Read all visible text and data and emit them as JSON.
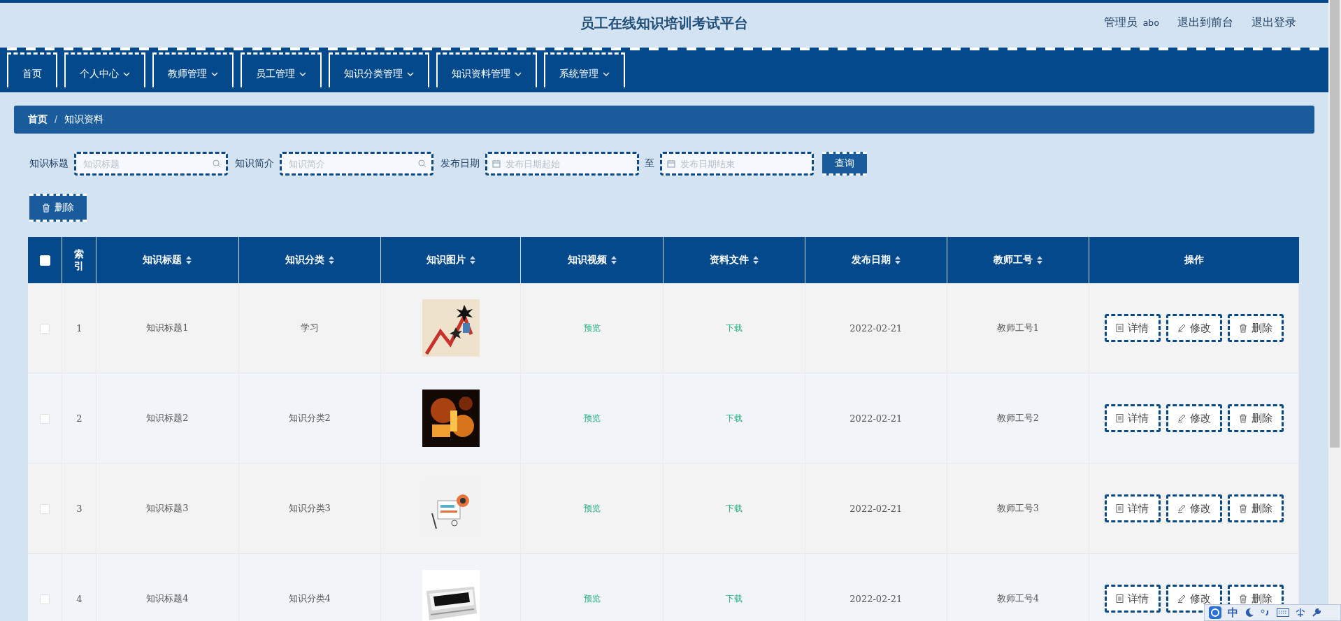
{
  "header": {
    "title": "员工在线知识培训考试平台",
    "role": "管理员",
    "username": "abo",
    "links": [
      "退出到前台",
      "退出登录"
    ]
  },
  "nav": [
    {
      "label": "首页",
      "dropdown": false
    },
    {
      "label": "个人中心",
      "dropdown": true
    },
    {
      "label": "教师管理",
      "dropdown": true
    },
    {
      "label": "员工管理",
      "dropdown": true
    },
    {
      "label": "知识分类管理",
      "dropdown": true
    },
    {
      "label": "知识资料管理",
      "dropdown": true
    },
    {
      "label": "系统管理",
      "dropdown": true
    }
  ],
  "breadcrumb": {
    "items": [
      "首页",
      "知识资料"
    ],
    "separator": "/"
  },
  "search": {
    "fields": [
      {
        "label": "知识标题",
        "placeholder": "知识标题"
      },
      {
        "label": "知识简介",
        "placeholder": "知识简介"
      }
    ],
    "date_range": {
      "label": "发布日期",
      "start_placeholder": "发布日期起始",
      "separator": "至",
      "end_placeholder": "发布日期结束"
    },
    "button": "查询"
  },
  "toolbar": {
    "delete_button": "删除"
  },
  "table": {
    "all_checked": false,
    "columns": [
      {
        "label": "索引",
        "sortable": false
      },
      {
        "label": "知识标题",
        "sortable": true
      },
      {
        "label": "知识分类",
        "sortable": true
      },
      {
        "label": "知识图片",
        "sortable": true
      },
      {
        "label": "知识视频",
        "sortable": true
      },
      {
        "label": "资料文件",
        "sortable": true
      },
      {
        "label": "发布日期",
        "sortable": true
      },
      {
        "label": "教师工号",
        "sortable": true
      },
      {
        "label": "操作",
        "sortable": false
      }
    ],
    "rows": [
      {
        "checked": false,
        "index": "1",
        "title": "知识标题1",
        "category": "学习",
        "image": {
          "kind": "picture"
        },
        "video": "预览",
        "file": "下载",
        "date": "2022-02-21",
        "teacher_id": "教师工号1",
        "actions": [
          "详情",
          "修改",
          "删除"
        ]
      },
      {
        "checked": false,
        "index": "2",
        "title": "知识标题2",
        "category": "知识分类2",
        "image": {
          "kind": "picture"
        },
        "video": "预览",
        "file": "下载",
        "date": "2022-02-21",
        "teacher_id": "教师工号2",
        "actions": [
          "详情",
          "修改",
          "删除"
        ]
      },
      {
        "checked": false,
        "index": "3",
        "title": "知识标题3",
        "category": "知识分类3",
        "image": {
          "kind": "picture"
        },
        "video": "预览",
        "file": "下载",
        "date": "2022-02-21",
        "teacher_id": "教师工号3",
        "actions": [
          "详情",
          "修改",
          "删除"
        ]
      },
      {
        "checked": false,
        "index": "4",
        "title": "知识标题4",
        "category": "知识分类4",
        "image": {
          "kind": "picture"
        },
        "video": "预览",
        "file": "下载",
        "date": "2022-02-21",
        "teacher_id": "教师工号4",
        "actions": [
          "详情",
          "修改",
          "删除"
        ]
      }
    ]
  },
  "ime_bar": {
    "mode": "中"
  }
}
